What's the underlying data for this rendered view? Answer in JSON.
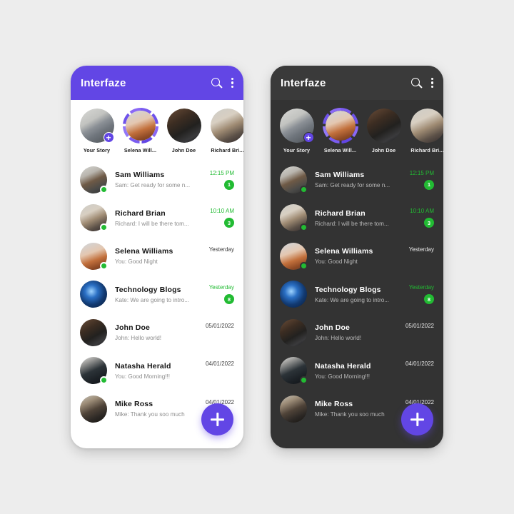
{
  "theme": {
    "page_background": "#EDEDED",
    "accent_purple": "#6246E5",
    "status_green": "#22BB33",
    "dark_surface": "#333333",
    "dark_appbar": "#3A3A3A",
    "light_surface": "#FFFFFF"
  },
  "app": {
    "title": "Interfaze",
    "search_icon": "search-icon",
    "menu_icon": "more-vertical-icon",
    "fab_icon": "plus-icon",
    "fab_label": "+"
  },
  "stories": [
    {
      "label": "Your Story",
      "has_ring": false,
      "has_add_badge": true,
      "add_label": "+",
      "avatar": "desk-laptop-photo"
    },
    {
      "label": "Selena Will...",
      "has_ring": true,
      "has_add_badge": false,
      "avatar": "redhead-woman-photo"
    },
    {
      "label": "John Doe",
      "has_ring": false,
      "has_add_badge": false,
      "avatar": "man-at-laptop-photo"
    },
    {
      "label": "Richard Bri...",
      "has_ring": false,
      "has_add_badge": false,
      "avatar": "man-with-hat-photo"
    }
  ],
  "chats": [
    {
      "name": "Sam Williams",
      "message": "Sam: Get ready for some n...",
      "time": "12:15 PM",
      "unread_count": "1",
      "has_unread": true,
      "online": true,
      "avatar": "young-man-photo"
    },
    {
      "name": "Richard Brian",
      "message": "Richard: I will be there tom...",
      "time": "10:10 AM",
      "unread_count": "3",
      "has_unread": true,
      "online": true,
      "avatar": "man-with-hat-photo"
    },
    {
      "name": "Selena Williams",
      "message": "You: Good Night",
      "time": "Yesterday",
      "unread_count": "",
      "has_unread": false,
      "online": true,
      "avatar": "redhead-woman-photo"
    },
    {
      "name": "Technology Blogs",
      "message": "Kate: We are going to intro...",
      "time": "Yesterday",
      "unread_count": "8",
      "has_unread": true,
      "online": false,
      "avatar": "tech-globe-photo"
    },
    {
      "name": "John Doe",
      "message": "John: Hello world!",
      "time": "05/01/2022",
      "unread_count": "",
      "has_unread": false,
      "online": false,
      "avatar": "man-at-laptop-photo"
    },
    {
      "name": "Natasha Herald",
      "message": "You: Good Morning!!!",
      "time": "04/01/2022",
      "unread_count": "",
      "has_unread": false,
      "online": true,
      "avatar": "woman-dark-jacket-photo"
    },
    {
      "name": "Mike Ross",
      "message": "Mike: Thank you soo much",
      "time": "04/01/2022",
      "unread_count": "",
      "has_unread": false,
      "online": false,
      "avatar": "man-jacket-outdoor-photo"
    }
  ]
}
